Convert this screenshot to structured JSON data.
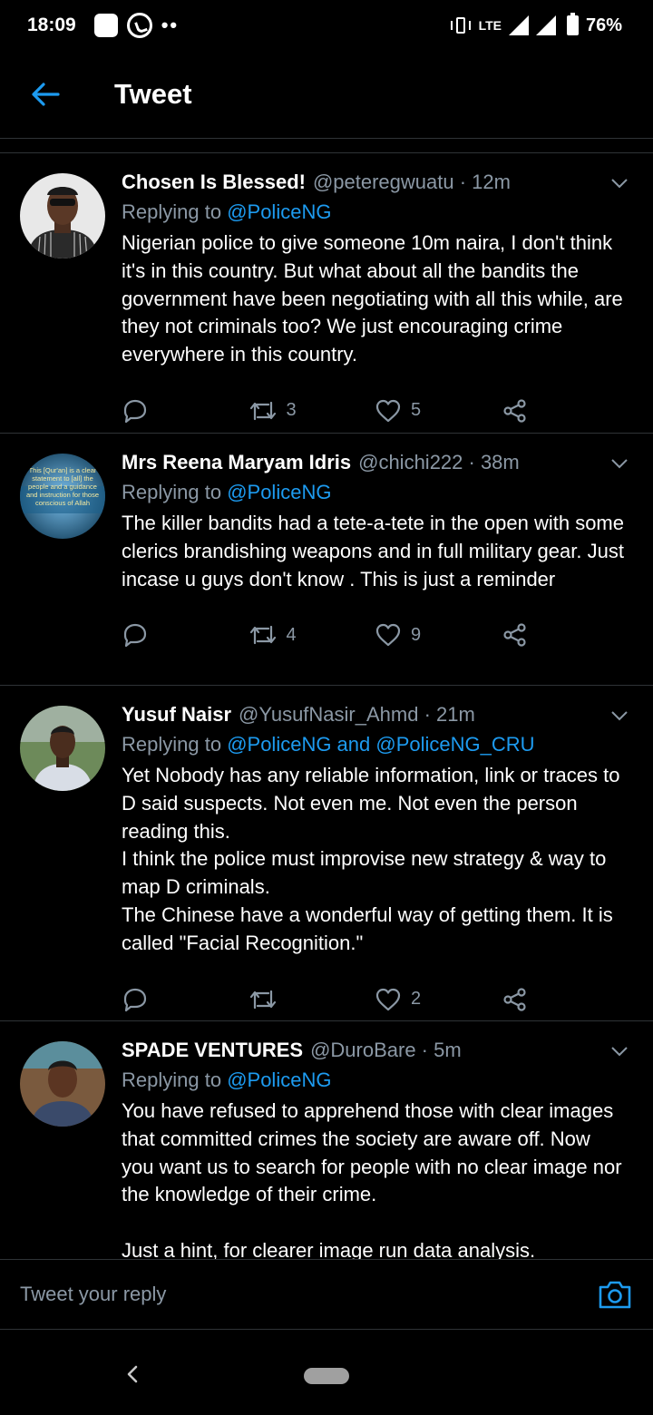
{
  "status_bar": {
    "time": "18:09",
    "network": "LTE",
    "battery": "76%",
    "icons": [
      "notification-square-icon",
      "whatsapp-icon",
      "more-dots-icon",
      "vibrate-icon",
      "signal-icon",
      "battery-icon"
    ]
  },
  "header": {
    "back_icon": "arrow-left-icon",
    "title": "Tweet"
  },
  "tweets": [
    {
      "name": "Chosen Is Blessed!",
      "handle": "@peteregwuatu · 12m",
      "replying_prefix": "Replying to ",
      "mentions": "@PoliceNG",
      "text": "Nigerian police to give someone 10m naira, I don't think it's in this country. But what about all the bandits the government have been negotiating with all this while, are they not criminals too? We just encouraging crime everywhere in this country.",
      "retweets": "3",
      "likes": "5"
    },
    {
      "name": "Mrs Reena Maryam Idris",
      "handle": "@chichi222 · 38m",
      "replying_prefix": "Replying to ",
      "mentions": "@PoliceNG",
      "text": "The killer bandits had a  tete-a-tete in the open with some clerics brandishing weapons and in full military gear. Just incase u guys don't know . This is just a reminder",
      "retweets": "4",
      "likes": "9",
      "avatar_text": "This [Qur'an] is a clear statement to [all] the people and a guidance and instruction for those conscious of Allah"
    },
    {
      "name": "Yusuf Naisr",
      "handle": "@YusufNasir_Ahmd · 21m",
      "replying_prefix": "Replying to ",
      "mentions": "@PoliceNG and @PoliceNG_CRU",
      "text": "Yet Nobody has any reliable information, link or traces to D said suspects. Not even me. Not even the person reading this.\nI think the police must improvise new strategy & way to map D criminals.\nThe Chinese have a wonderful way of getting them. It is called \"Facial Recognition.\"",
      "retweets": "",
      "likes": "2"
    },
    {
      "name": "SPADE VENTURES",
      "handle": "@DuroBare · 5m",
      "replying_prefix": "Replying to ",
      "mentions": "@PoliceNG",
      "text": "You have refused to apprehend those with clear images that committed crimes the society are aware off. Now you want us to search for people with no clear image nor the knowledge of their crime.\n\nJust a hint, for clearer image run data analysis.",
      "retweets": "",
      "likes": ""
    }
  ],
  "reply_bar": {
    "placeholder": "Tweet your reply",
    "camera_icon": "camera-icon"
  },
  "colors": {
    "background": "#000000",
    "accent": "#1d9bf0",
    "muted": "#8b98a5",
    "divider": "#2f3336"
  }
}
